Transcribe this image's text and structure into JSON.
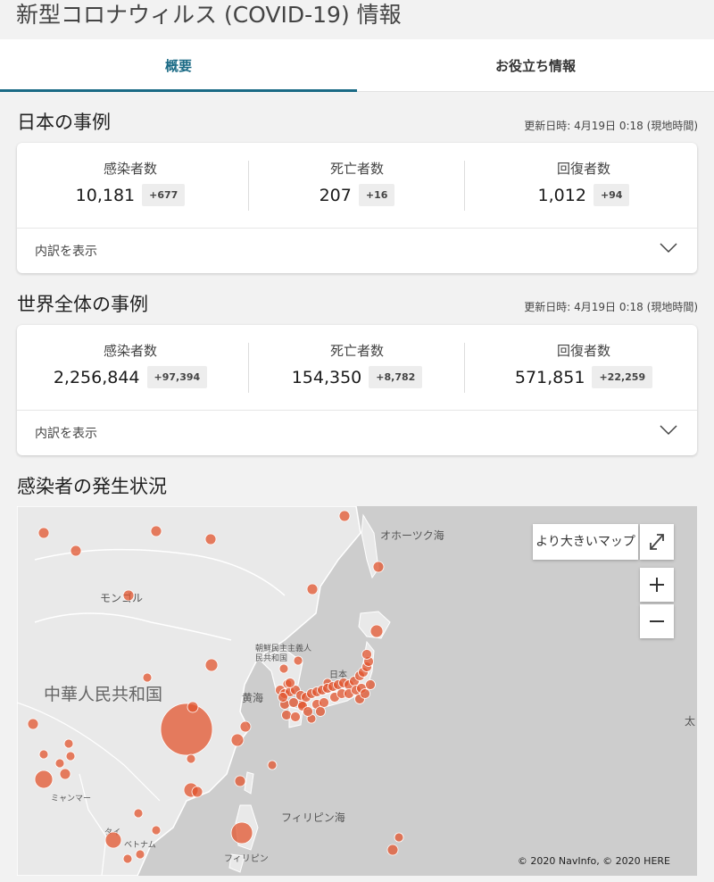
{
  "page": {
    "title": "新型コロナウィルス (COVID-19) 情報"
  },
  "tabs": [
    {
      "label": "概要",
      "active": true
    },
    {
      "label": "お役立ち情報",
      "active": false
    }
  ],
  "japan": {
    "title": "日本の事例",
    "updated": "更新日時: 4月19日 0:18 (現地時間)",
    "stats": [
      {
        "label": "感染者数",
        "value": "10,181",
        "delta": "+677"
      },
      {
        "label": "死亡者数",
        "value": "207",
        "delta": "+16"
      },
      {
        "label": "回復者数",
        "value": "1,012",
        "delta": "+94"
      }
    ],
    "breakdown_label": "内訳を表示"
  },
  "world": {
    "title": "世界全体の事例",
    "updated": "更新日時: 4月19日 0:18 (現地時間)",
    "stats": [
      {
        "label": "感染者数",
        "value": "2,256,844",
        "delta": "+97,394"
      },
      {
        "label": "死亡者数",
        "value": "154,350",
        "delta": "+8,782"
      },
      {
        "label": "回復者数",
        "value": "571,851",
        "delta": "+22,259"
      }
    ],
    "breakdown_label": "内訳を表示"
  },
  "map": {
    "title": "感染者の発生状況",
    "big_map_label": "より大きいマップ",
    "zoom_in": "+",
    "zoom_out": "−",
    "expand_icon": "expand-arrows-icon",
    "labels": {
      "okhotsk": "オホーツク海",
      "mongolia": "モンゴル",
      "north_korea": "朝鮮民主主義人民共和国",
      "japan": "日本",
      "china": "中華人民共和国",
      "yellow_sea": "黄海",
      "philippine_sea": "フィリピン海",
      "myanmar": "ミャンマー",
      "thailand": "タイ",
      "vietnam": "ベトナム",
      "philippines": "フィリピン",
      "pacific": "太"
    },
    "copyright": "© 2020 NavInfo, © 2020 HERE",
    "marker_color": "#e2542d"
  }
}
